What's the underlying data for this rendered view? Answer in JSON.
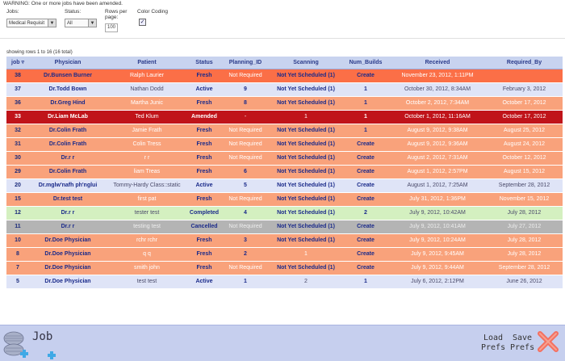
{
  "warning": "WARNING: One or more jobs have been amended.",
  "filters": {
    "jobs_label": "Jobs:",
    "jobs_value": "Medical Requisit",
    "status_label": "Status:",
    "status_value": "All",
    "rows_label": "Rows per page:",
    "rows_value": "100",
    "color_label": "Color Coding",
    "color_checked": "✓"
  },
  "showing": "showing rows 1 to 16 (16 total)",
  "columns": {
    "job": "job",
    "physician": "Physician",
    "patient": "Patient",
    "status": "Status",
    "planning": "Planning_ID",
    "scanning": "Scanning",
    "builds": "Num_Builds",
    "received": "Received",
    "required": "Required_By"
  },
  "rows": [
    {
      "job": "38",
      "physician": "Dr.Bunsen Burner",
      "patient": "Ralph Laurier",
      "status": "Fresh",
      "planning": "Not Required",
      "scanning": "Not Yet Scheduled (1)",
      "builds": "Create",
      "received": "November 23, 2012, 1:11PM",
      "required": "",
      "color": "darkorange"
    },
    {
      "job": "37",
      "physician": "Dr.Todd Bown",
      "patient": "Nathan Dodd",
      "status": "Active",
      "planning": "9",
      "scanning": "Not Yet Scheduled (1)",
      "builds": "1",
      "received": "October 30, 2012, 8:34AM",
      "required": "February 3, 2012",
      "color": "blue"
    },
    {
      "job": "36",
      "physician": "Dr.Greg Hind",
      "patient": "Martha Junic",
      "status": "Fresh",
      "planning": "8",
      "scanning": "Not Yet Scheduled (1)",
      "builds": "1",
      "received": "October 2, 2012, 7:34AM",
      "required": "October 17, 2012",
      "color": "orange"
    },
    {
      "job": "33",
      "physician": "Dr.Liam McLab",
      "patient": "Ted Klum",
      "status": "Amended",
      "planning": "-",
      "scanning": "1",
      "builds": "1",
      "received": "October 1, 2012, 11:16AM",
      "required": "October 17, 2012",
      "color": "red"
    },
    {
      "job": "32",
      "physician": "Dr.Colin Frath",
      "patient": "Jamie Frath",
      "status": "Fresh",
      "planning": "Not Required",
      "scanning": "Not Yet Scheduled (1)",
      "builds": "1",
      "received": "August 9, 2012, 9:38AM",
      "required": "August 25, 2012",
      "color": "orange"
    },
    {
      "job": "31",
      "physician": "Dr.Colin Frath",
      "patient": "Colin Tress",
      "status": "Fresh",
      "planning": "Not Required",
      "scanning": "Not Yet Scheduled (1)",
      "builds": "Create",
      "received": "August 9, 2012, 9:36AM",
      "required": "August 24, 2012",
      "color": "orange"
    },
    {
      "job": "30",
      "physician": "Dr.r r",
      "patient": "r r",
      "status": "Fresh",
      "planning": "Not Required",
      "scanning": "Not Yet Scheduled (1)",
      "builds": "Create",
      "received": "August 2, 2012, 7:31AM",
      "required": "October 12, 2012",
      "color": "orange"
    },
    {
      "job": "29",
      "physician": "Dr.Colin Frath",
      "patient": "liam Treas",
      "status": "Fresh",
      "planning": "6",
      "scanning": "Not Yet Scheduled (1)",
      "builds": "Create",
      "received": "August 1, 2012, 2:57PM",
      "required": "August 15, 2012",
      "color": "orange"
    },
    {
      "job": "20",
      "physician": "Dr.mglw'nafh ph'nglui",
      "patient": "Tommy-Hardy Class::static",
      "status": "Active",
      "planning": "5",
      "scanning": "Not Yet Scheduled (1)",
      "builds": "Create",
      "received": "August 1, 2012, 7:25AM",
      "required": "September 28, 2012",
      "color": "blue"
    },
    {
      "job": "15",
      "physician": "Dr.test test",
      "patient": "first pat",
      "status": "Fresh",
      "planning": "Not Required",
      "scanning": "Not Yet Scheduled (1)",
      "builds": "Create",
      "received": "July 31, 2012, 1:36PM",
      "required": "November 15, 2012",
      "color": "orange"
    },
    {
      "job": "12",
      "physician": "Dr.r r",
      "patient": "tester test",
      "status": "Completed",
      "planning": "4",
      "scanning": "Not Yet Scheduled (1)",
      "builds": "2",
      "received": "July 9, 2012, 10:42AM",
      "required": "July 28, 2012",
      "color": "green"
    },
    {
      "job": "11",
      "physician": "Dr.r r",
      "patient": "testing test",
      "status": "Cancelled",
      "planning": "Not Required",
      "scanning": "Not Yet Scheduled (1)",
      "builds": "Create",
      "received": "July 9, 2012, 10:41AM",
      "required": "July 27, 2012",
      "color": "gray"
    },
    {
      "job": "10",
      "physician": "Dr.Doe Physician",
      "patient": "rchr rchr",
      "status": "Fresh",
      "planning": "3",
      "scanning": "Not Yet Scheduled (1)",
      "builds": "Create",
      "received": "July 9, 2012, 10:24AM",
      "required": "July 28, 2012",
      "color": "orange"
    },
    {
      "job": "8",
      "physician": "Dr.Doe Physician",
      "patient": "q q",
      "status": "Fresh",
      "planning": "2",
      "scanning": "1",
      "builds": "Create",
      "received": "July 9, 2012, 9:45AM",
      "required": "July 28, 2012",
      "color": "orange"
    },
    {
      "job": "7",
      "physician": "Dr.Doe Physician",
      "patient": "smith john",
      "status": "Fresh",
      "planning": "Not Required",
      "scanning": "Not Yet Scheduled (1)",
      "builds": "Create",
      "received": "July 9, 2012, 9:44AM",
      "required": "September 28, 2012",
      "color": "orange"
    },
    {
      "job": "5",
      "physician": "Dr.Doe Physician",
      "patient": "test test",
      "status": "Active",
      "planning": "1",
      "scanning": "2",
      "builds": "1",
      "received": "July 6, 2012, 2:12PM",
      "required": "June 26, 2012",
      "color": "blue"
    }
  ],
  "footer": {
    "title": "Job",
    "load_label_1": "Load",
    "load_label_2": "Prefs",
    "save_label_1": "Save",
    "save_label_2": "Prefs"
  },
  "icons": {
    "job_logo": "job-stack-icon",
    "close": "close-x-icon",
    "sort": "sort-down-icon"
  },
  "colors": {
    "header_bg": "#c8d3ef",
    "orange": "#f9a27b",
    "darkorange": "#fb6f47",
    "red": "#c0141a",
    "blue": "#dfe4f7",
    "green": "#d4f0c0",
    "gray": "#b4b4b4",
    "bottom_bar": "#c6cfee"
  }
}
